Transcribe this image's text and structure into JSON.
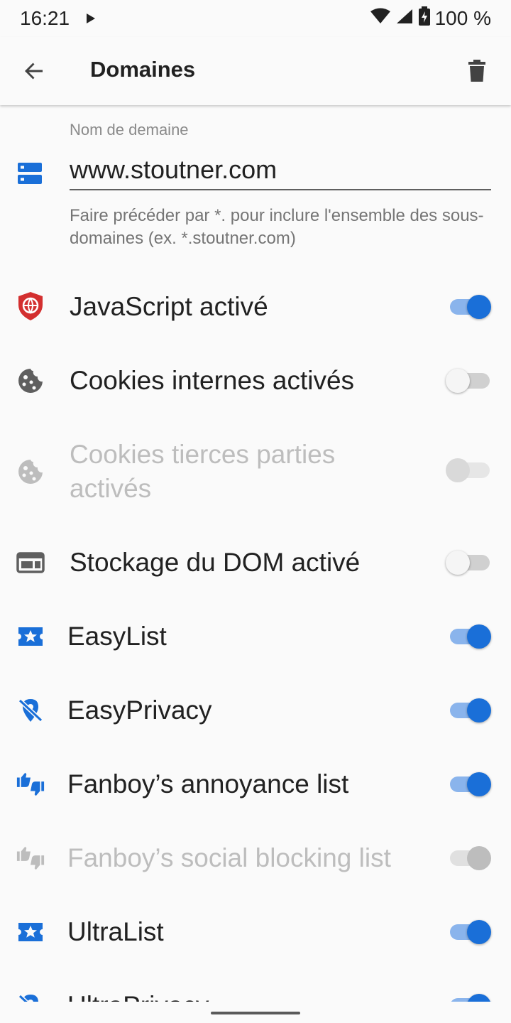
{
  "status_bar": {
    "time": "16:21",
    "battery": "100 %"
  },
  "toolbar": {
    "title": "Domaines"
  },
  "domain": {
    "label": "Nom de demaine",
    "value": "www.stoutner.com",
    "hint": "Faire précéder par *. pour inclure l'ensemble des sous-domaines (ex. *.stoutner.com)"
  },
  "settings": [
    {
      "label": "JavaScript activé",
      "checked": true,
      "enabled": true,
      "icon": "javascript-shield-icon"
    },
    {
      "label": "Cookies internes activés",
      "checked": false,
      "enabled": true,
      "icon": "cookie-icon"
    },
    {
      "label": "Cookies tierces parties activés",
      "checked": false,
      "enabled": false,
      "icon": "cookie-icon"
    },
    {
      "label": "Stockage du DOM activé",
      "checked": false,
      "enabled": true,
      "icon": "web-storage-icon"
    },
    {
      "label": "EasyList",
      "checked": true,
      "enabled": true,
      "icon": "easylist-ticket-star-icon"
    },
    {
      "label": "EasyPrivacy",
      "checked": true,
      "enabled": true,
      "icon": "location-off-icon"
    },
    {
      "label": "Fanboy’s annoyance list",
      "checked": true,
      "enabled": true,
      "icon": "thumbs-updown-icon"
    },
    {
      "label": "Fanboy’s social blocking list",
      "checked": true,
      "enabled": false,
      "icon": "thumbs-updown-icon"
    },
    {
      "label": "UltraList",
      "checked": true,
      "enabled": true,
      "icon": "easylist-ticket-star-icon"
    },
    {
      "label": "UltraPrivacy",
      "checked": true,
      "enabled": true,
      "icon": "location-off-icon"
    }
  ],
  "colors": {
    "accent": "#1a6fd8",
    "accent_track": "#8ab4ec",
    "javascript_icon": "#d32f2f",
    "icon_gray": "#5f5f5f",
    "disabled_text": "#bdbdbd"
  }
}
